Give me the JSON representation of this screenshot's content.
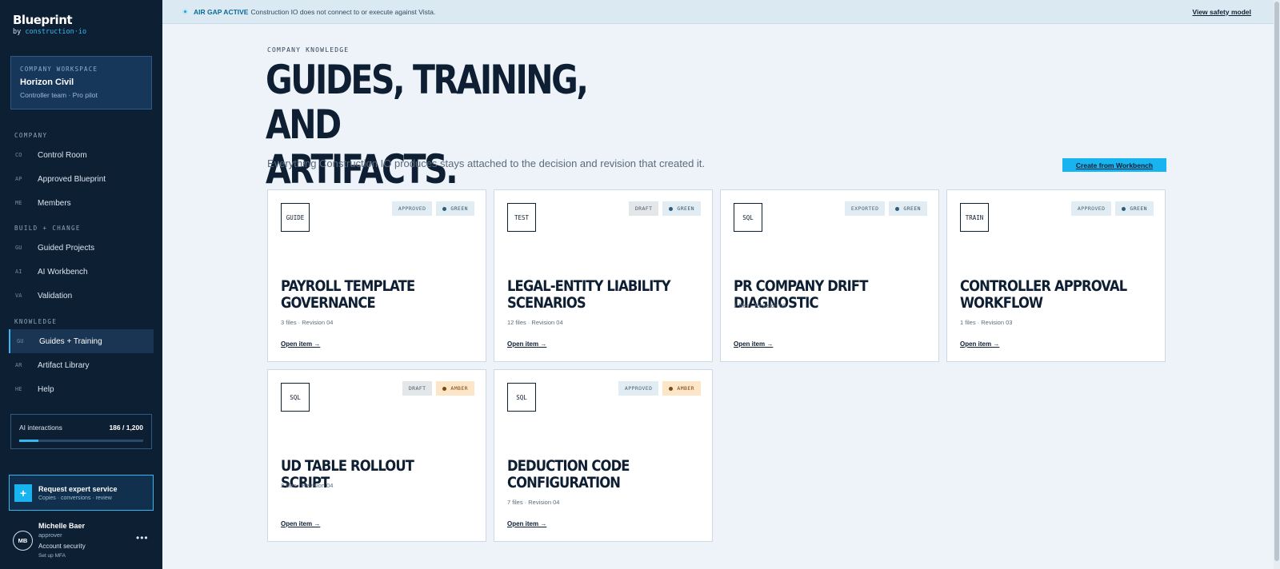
{
  "brand": {
    "name": "Blueprint",
    "by": "by ",
    "product": "construction·io"
  },
  "workspace": {
    "label": "COMPANY WORKSPACE",
    "name": "Horizon Civil",
    "sub": "Controller team · Pro pilot"
  },
  "nav": {
    "sections": [
      "COMPANY",
      "BUILD + CHANGE",
      "KNOWLEDGE"
    ],
    "items": [
      {
        "code": "CO",
        "label": "Control Room"
      },
      {
        "code": "AP",
        "label": "Approved Blueprint"
      },
      {
        "code": "ME",
        "label": "Members"
      },
      {
        "code": "GU",
        "label": "Guided Projects"
      },
      {
        "code": "AI",
        "label": "AI Workbench"
      },
      {
        "code": "VA",
        "label": "Validation"
      },
      {
        "code": "GU",
        "label": "Guides + Training",
        "active": true
      },
      {
        "code": "AR",
        "label": "Artifact Library"
      },
      {
        "code": "HE",
        "label": "Help"
      }
    ]
  },
  "ai_usage": {
    "label": "AI interactions",
    "count": "186 / 1,200",
    "used": 186,
    "limit": 1200
  },
  "expert": {
    "icon": "+",
    "title": "Request expert service",
    "sub": "Copies · conversions · review"
  },
  "user": {
    "initials": "MB",
    "name": "Michelle Baer",
    "role": "approver",
    "security": "Account security",
    "mfa": "Set up MFA",
    "more": "•••"
  },
  "banner": {
    "strong": "AIR GAP ACTIVE",
    "text": "Construction IO does not connect to or execute against Vista.",
    "link": "View safety model"
  },
  "page": {
    "kicker": "COMPANY KNOWLEDGE",
    "title_line1": "GUIDES, TRAINING, AND",
    "title_line2": "ARTIFACTS.",
    "subtitle": "Everything Construction IO produces stays attached to the decision and revision that created it.",
    "create_label": "Create from Workbench"
  },
  "cards": [
    {
      "type": "GUIDE",
      "state": "APPROVED",
      "health": "GREEN",
      "title_line1": "PAYROLL TEMPLATE",
      "title_line2": "GOVERNANCE",
      "meta": "3 files · Revision 04",
      "link": "Open item →"
    },
    {
      "type": "TEST",
      "state": "DRAFT",
      "health": "GREEN",
      "title_line1": "LEGAL-ENTITY LIABILITY",
      "title_line2": "SCENARIOS",
      "meta": "12 files · Revision 04",
      "link": "Open item →"
    },
    {
      "type": "SQL",
      "state": "EXPORTED",
      "health": "GREEN",
      "title_line1": "PR COMPANY DRIFT DIAGNOSTIC",
      "title_line2": "",
      "meta": "1 files · Revision 03",
      "link": "Open item →"
    },
    {
      "type": "TRAIN",
      "state": "APPROVED",
      "health": "GREEN",
      "title_line1": "CONTROLLER APPROVAL",
      "title_line2": "WORKFLOW",
      "meta": "1 files · Revision 03",
      "link": "Open item →"
    },
    {
      "type": "SQL",
      "state": "DRAFT",
      "health": "AMBER",
      "title_line1": "UD TABLE ROLLOUT SCRIPT",
      "title_line2": "",
      "meta": "2 files · Revision 04",
      "link": "Open item →"
    },
    {
      "type": "SQL",
      "state": "APPROVED",
      "health": "AMBER",
      "title_line1": "DEDUCTION CODE",
      "title_line2": "CONFIGURATION",
      "meta": "7 files · Revision 04",
      "link": "Open item →"
    }
  ],
  "colors": {
    "sidebar": "#0d1f33",
    "accent": "#18b4f0",
    "green_badge": "#e2edf3",
    "amber_badge": "#fde5c8"
  }
}
